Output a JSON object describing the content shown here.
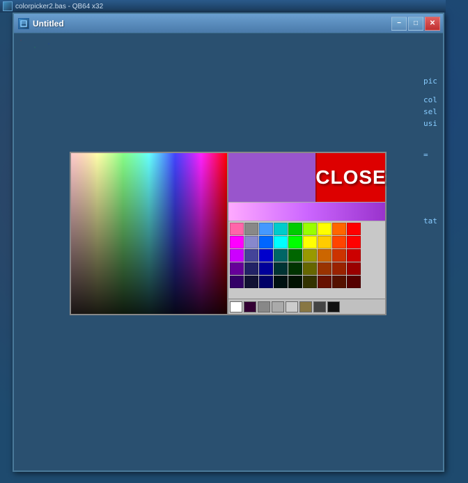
{
  "app": {
    "title": "colorpicker2.bas - QB64 x32",
    "window_title": "Untitled"
  },
  "titlebar": {
    "minimize_label": "−",
    "maximize_label": "□",
    "close_label": "✕"
  },
  "colorpicker": {
    "close_button_label": "CLOSE",
    "selected_color": "#9955cc",
    "gradient_colors": [
      "#ffaaff",
      "#cc66ff",
      "#9933cc"
    ],
    "swatches": [
      [
        "#ff66aa",
        "#888888",
        "#4499ff",
        "#00cccc",
        "#00cc00",
        "#99ff00",
        "#ffff00",
        "#ff6600",
        "#ff0000"
      ],
      [
        "#ff00ff",
        "#8888cc",
        "#0000ff",
        "#00ffff",
        "#00ff00",
        "#ffff00",
        "#ffcc00",
        "#ff6600",
        "#ff0000"
      ],
      [
        "#cc00ff",
        "#444499",
        "#0000cc",
        "#006666",
        "#006600",
        "#999900",
        "#cc6600",
        "#cc3300",
        "#cc0000"
      ],
      [
        "#660099",
        "#222266",
        "#000099",
        "#003333",
        "#003300",
        "#666600",
        "#993300",
        "#992200",
        "#990000"
      ],
      [
        "#330066",
        "#111133",
        "#000066",
        "#001111",
        "#001100",
        "#333300",
        "#661100",
        "#551100",
        "#550000"
      ]
    ],
    "bottom_swatches": {
      "white": "#ffffff",
      "dark_purple": "#330033",
      "gray1": "#888888",
      "gray2": "#aaaaaa",
      "gray3": "#cccccc",
      "olive": "#887744",
      "dark_gray": "#444444",
      "black": "#111111"
    }
  },
  "sidebar": {
    "text1": "pic",
    "text2": "col",
    "text3": "sel",
    "text4": "usi",
    "text5": "tat"
  }
}
